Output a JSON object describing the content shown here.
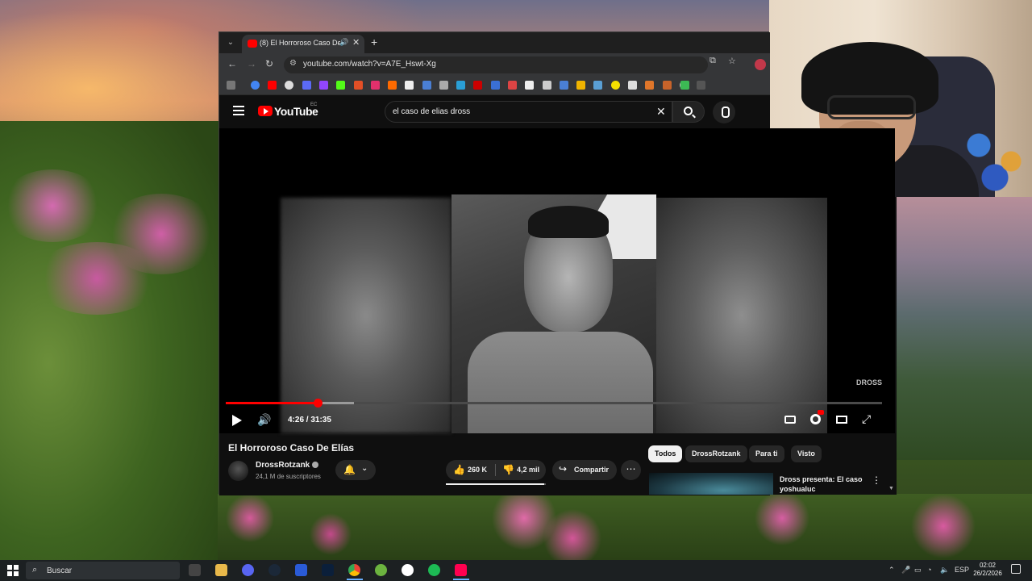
{
  "browser": {
    "tab_title": "(8) El Horroroso Caso De Elí",
    "url": "youtube.com/watch?v=A7E_Hswt-Xg",
    "profile_badge": "2"
  },
  "youtube": {
    "logo_text": "YouTube",
    "country_code": "EC",
    "search_query": "el caso de elias dross",
    "player": {
      "time": "4:26 / 31:35",
      "progress": 0.14,
      "buffered": 0.195,
      "watermark": "DROSS"
    },
    "video": {
      "title": "El Horroroso Caso De Elías",
      "channel": "DrossRotzank",
      "subscribers": "24,1 M de suscriptores",
      "likes": "260 K",
      "dislikes": "4,2 mil",
      "like_ratio": 0.98,
      "share_label": "Compartir",
      "more_label": "⋯"
    },
    "chips": [
      "Todos",
      "DrossRotzank",
      "Para ti",
      "Visto"
    ],
    "recommendation": {
      "title": "Dross presenta: El caso yoshualuc"
    }
  },
  "taskbar": {
    "search_label": "Buscar",
    "language": "ESP",
    "time": "02:02",
    "date": "26/2/2026"
  },
  "colors": {
    "youtube_red": "#ff0000",
    "yt_background": "#0f0f0f",
    "browser_frame": "#353638",
    "taskbar": "#1c2022"
  }
}
